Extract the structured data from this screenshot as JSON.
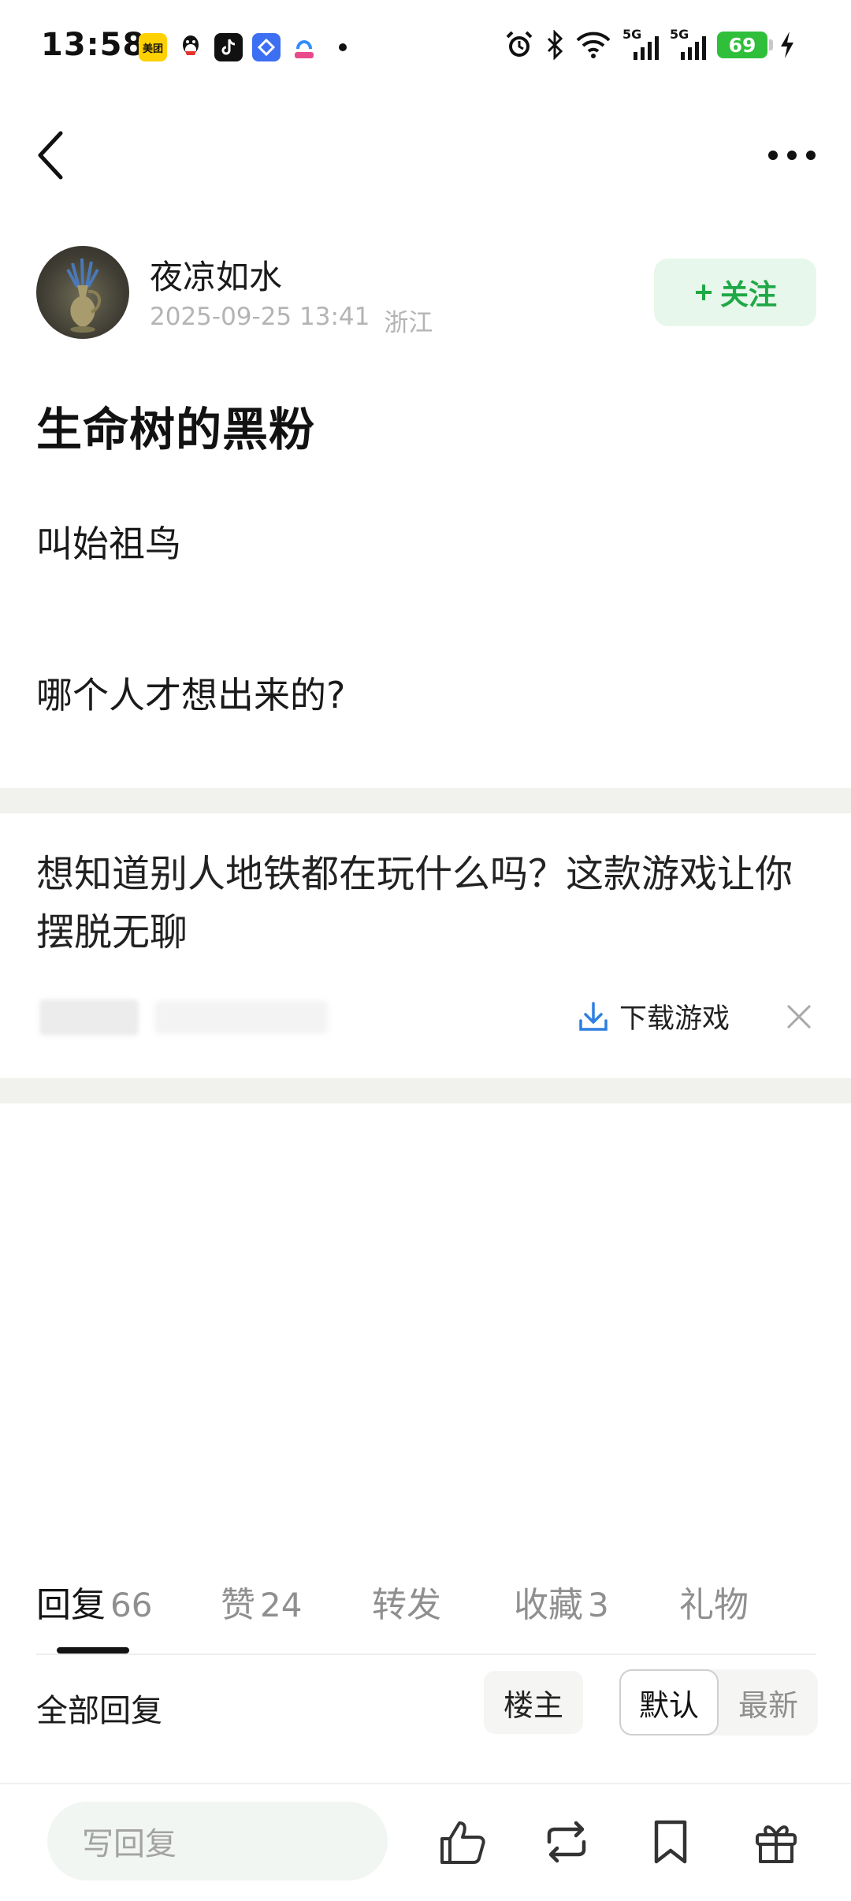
{
  "status_bar": {
    "time": "13:58",
    "app_icons": [
      "meituan-icon",
      "qq-icon",
      "tiktok-icon",
      "app-icon",
      "app-icon"
    ],
    "meituan_label": "美团",
    "signal_label_1": "5G",
    "signal_label_2": "5G",
    "battery": "69"
  },
  "author": {
    "name": "夜凉如水",
    "date": "2025-09-25 13:41",
    "location": "浙江",
    "follow_label": "关注"
  },
  "post": {
    "title": "生命树的黑粉",
    "paragraphs": [
      "叫始祖鸟",
      "哪个人才想出来的?"
    ]
  },
  "ad": {
    "text": "想知道别人地铁都在玩什么吗？这款游戏让你摆脱无聊",
    "download_label": "下载游戏"
  },
  "tabs": [
    {
      "label": "回复",
      "count": "66",
      "active": true
    },
    {
      "label": "赞",
      "count": "24",
      "active": false
    },
    {
      "label": "转发",
      "count": "",
      "active": false
    },
    {
      "label": "收藏",
      "count": "3",
      "active": false
    },
    {
      "label": "礼物",
      "count": "",
      "active": false
    }
  ],
  "filter": {
    "all_replies": "全部回复",
    "owner_only": "楼主",
    "sort_default": "默认",
    "sort_latest": "最新"
  },
  "bottom_bar": {
    "reply_placeholder": "写回复",
    "icons": [
      "like-icon",
      "repost-icon",
      "bookmark-icon",
      "gift-icon"
    ]
  },
  "colors": {
    "accent_green": "#1fa846",
    "follow_bg": "#e7f7eb",
    "battery_green": "#2fbf3a",
    "divider": "#f1f1ee"
  }
}
